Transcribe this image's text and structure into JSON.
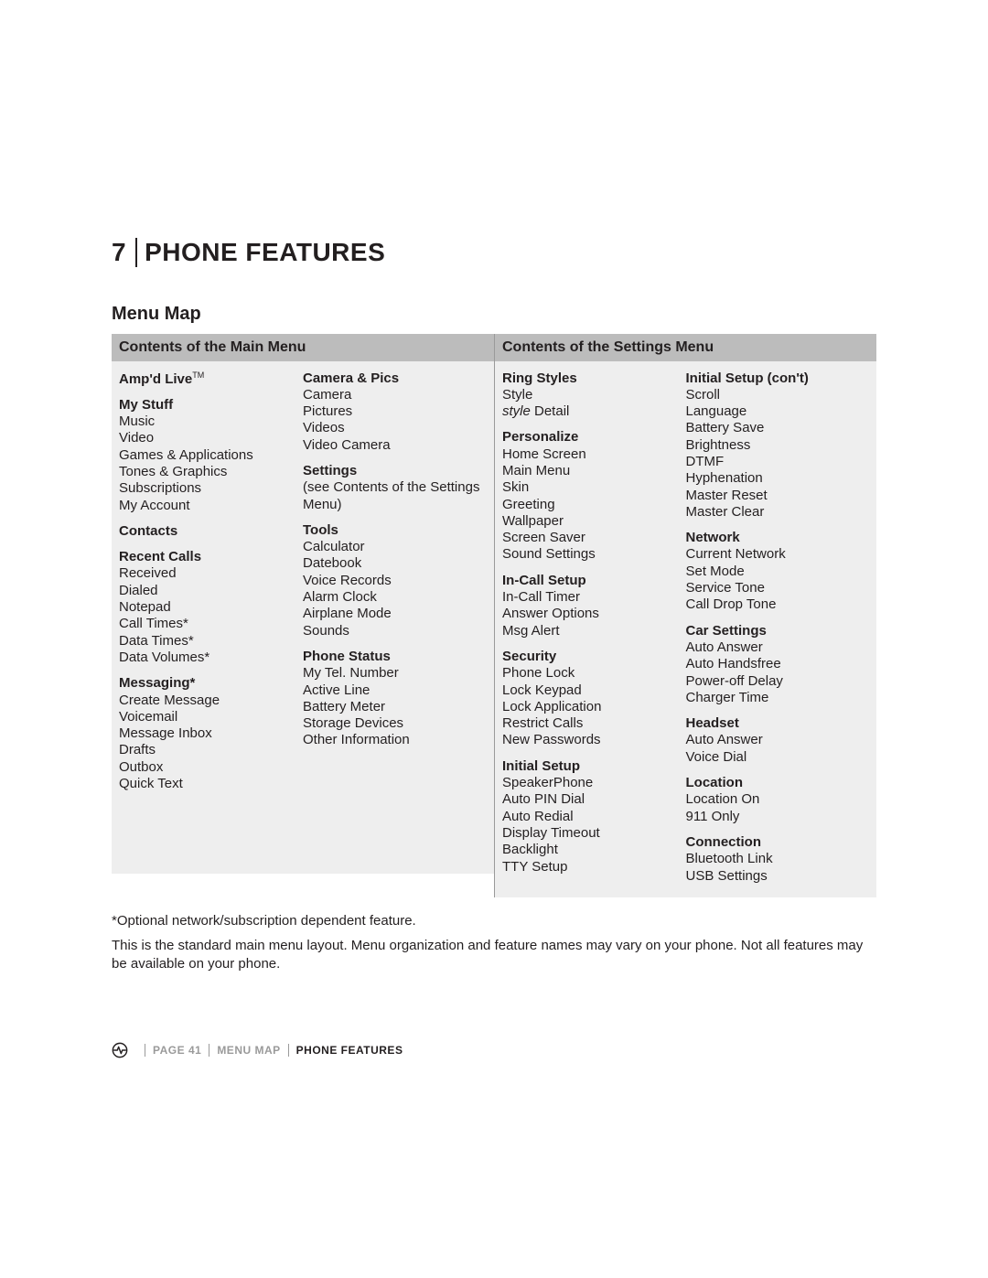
{
  "chapter": {
    "number": "7",
    "title": "PHONE FEATURES"
  },
  "section_title": "Menu Map",
  "main_menu": {
    "header": "Contents of the Main Menu",
    "col1": [
      {
        "title": "Amp'd Live",
        "tm": true,
        "items": []
      },
      {
        "title": "My Stuff",
        "items": [
          "Music",
          "Video",
          "Games & Applications",
          "Tones & Graphics",
          "Subscriptions",
          "My Account"
        ]
      },
      {
        "title": "Contacts",
        "items": []
      },
      {
        "title": "Recent Calls",
        "items": [
          "Received",
          "Dialed",
          "Notepad",
          "Call Times*",
          "Data Times*",
          "Data Volumes*"
        ]
      },
      {
        "title": "Messaging*",
        "items": [
          "Create Message",
          "Voicemail",
          "Message Inbox",
          "Drafts",
          "Outbox",
          "Quick Text"
        ]
      }
    ],
    "col2": [
      {
        "title": "Camera & Pics",
        "items": [
          "Camera",
          "Pictures",
          "Videos",
          "Video Camera"
        ]
      },
      {
        "title": "Settings",
        "note": "(see Contents of the Settings Menu)",
        "items": []
      },
      {
        "title": "Tools",
        "items": [
          "Calculator",
          "Datebook",
          "Voice Records",
          "Alarm Clock",
          "Airplane Mode",
          "Sounds"
        ]
      },
      {
        "title": "Phone Status",
        "items": [
          "My Tel. Number",
          "Active Line",
          "Battery Meter",
          "Storage Devices",
          "Other Information"
        ]
      }
    ]
  },
  "settings_menu": {
    "header": "Contents of the Settings Menu",
    "col1": [
      {
        "title": "Ring Styles",
        "items": [
          "Style",
          {
            "text": "style Detail",
            "emph_prefix": "style",
            "suffix": " Detail"
          }
        ]
      },
      {
        "title": "Personalize",
        "items": [
          "Home Screen",
          "Main Menu",
          "Skin",
          "Greeting",
          "Wallpaper",
          "Screen Saver",
          "Sound Settings"
        ]
      },
      {
        "title": "In-Call Setup",
        "items": [
          "In-Call Timer",
          "Answer Options",
          "Msg Alert"
        ]
      },
      {
        "title": "Security",
        "items": [
          "Phone Lock",
          "Lock Keypad",
          "Lock Application",
          "Restrict Calls",
          "New Passwords"
        ]
      },
      {
        "title": "Initial Setup",
        "items": [
          "SpeakerPhone",
          "Auto PIN Dial",
          "Auto Redial",
          "Display Timeout",
          "Backlight",
          "TTY Setup"
        ]
      }
    ],
    "col2": [
      {
        "title": "Initial Setup (con't)",
        "items": [
          "Scroll",
          "Language",
          "Battery Save",
          "Brightness",
          "DTMF",
          "Hyphenation",
          "Master Reset",
          "Master Clear"
        ]
      },
      {
        "title": "Network",
        "items": [
          "Current Network",
          "Set Mode",
          "Service Tone",
          "Call Drop Tone"
        ]
      },
      {
        "title": "Car Settings",
        "items": [
          "Auto Answer",
          "Auto Handsfree",
          "Power-off Delay",
          "Charger Time"
        ]
      },
      {
        "title": "Headset",
        "items": [
          "Auto Answer",
          "Voice Dial"
        ]
      },
      {
        "title": "Location",
        "items": [
          "Location On",
          "911 Only"
        ]
      },
      {
        "title": "Connection",
        "items": [
          "Bluetooth Link",
          "USB Settings"
        ]
      }
    ]
  },
  "footnotes": [
    "*Optional network/subscription dependent feature.",
    "This is the standard main menu layout. Menu organization and feature names may vary on your phone. Not all features may be available on your phone."
  ],
  "footer": {
    "page": "PAGE 41",
    "crumb1": "MENU MAP",
    "crumb2": "PHONE FEATURES"
  }
}
